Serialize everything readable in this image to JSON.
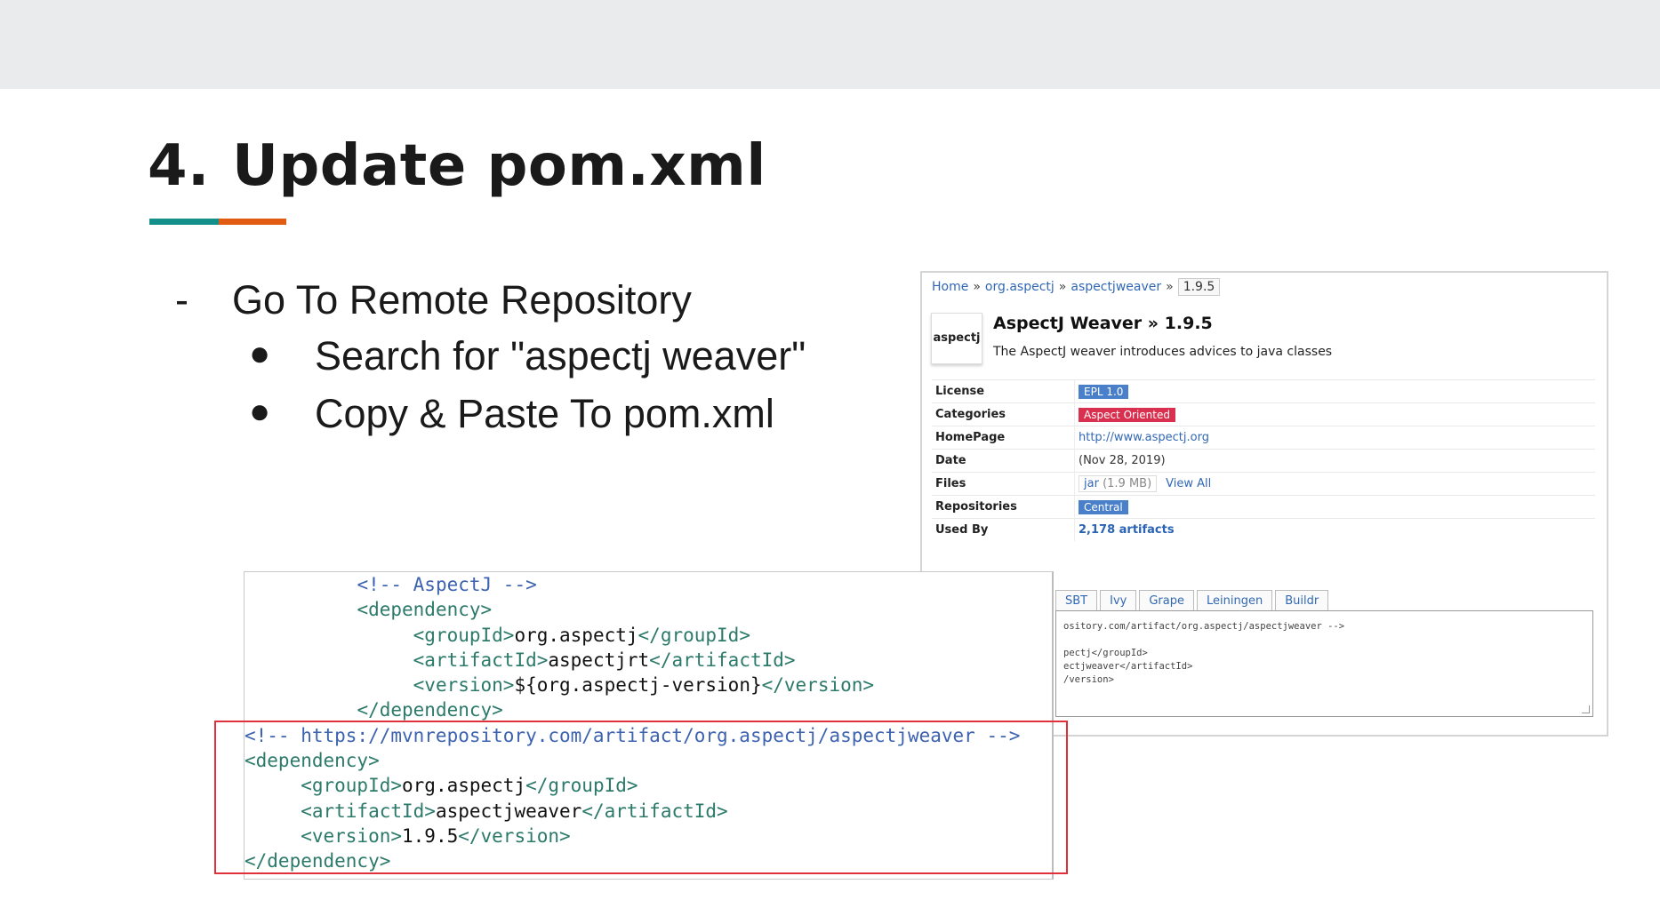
{
  "slide": {
    "number": "4.",
    "title": "Update pom.xml",
    "bullets": {
      "dash": "-",
      "main": "Go To Remote Repository",
      "dot": "●",
      "sub": [
        "Search for \"aspectj weaver\"",
        "Copy & Paste To pom.xml"
      ]
    },
    "accent_colors": [
      "#14908a",
      "#e25b12"
    ]
  },
  "mvn": {
    "breadcrumb": [
      "Home",
      "org.aspectj",
      "aspectjweaver",
      "1.9.5"
    ],
    "crumb_sep": "»",
    "logo_text": "aspectj",
    "artifact_title": "AspectJ Weaver » 1.9.5",
    "description": "The AspectJ weaver introduces advices to java classes",
    "rows": [
      {
        "key": "License",
        "value": "EPL 1.0"
      },
      {
        "key": "Categories",
        "value": "Aspect Oriented"
      },
      {
        "key": "HomePage",
        "value": "http://www.aspectj.org"
      },
      {
        "key": "Date",
        "value": "(Nov 28, 2019)"
      },
      {
        "key": "Files",
        "jar": "jar",
        "size": "(1.9 MB)",
        "view_all": "View All"
      },
      {
        "key": "Repositories",
        "value": "Central"
      },
      {
        "key": "Used By",
        "value": "2,178 artifacts"
      }
    ],
    "tabs": [
      "SBT",
      "Ivy",
      "Grape",
      "Leiningen",
      "Buildr"
    ],
    "snippet_lines": [
      "ository.com/artifact/org.aspectj/aspectjweaver -->",
      "",
      "pectj</groupId>",
      "ectjweaver</artifactId>",
      "/version>"
    ]
  },
  "code": {
    "existing_comment": "<!-- AspectJ -->",
    "existing": [
      "<dependency>",
      "<groupId>",
      "org.aspectj",
      "</groupId>",
      "<artifactId>",
      "aspectjrt",
      "</artifactId>",
      "<version>",
      "${org.aspectj-version}",
      "</version>",
      "</dependency>"
    ],
    "new_comment": "<!-- https://mvnrepository.com/artifact/org.aspectj/aspectjweaver -->",
    "new": [
      "<dependency>",
      "<groupId>",
      "org.aspectj",
      "</groupId>",
      "<artifactId>",
      "aspectjweaver",
      "</artifactId>",
      "<version>",
      "1.9.5",
      "</version>",
      "</dependency>"
    ]
  }
}
